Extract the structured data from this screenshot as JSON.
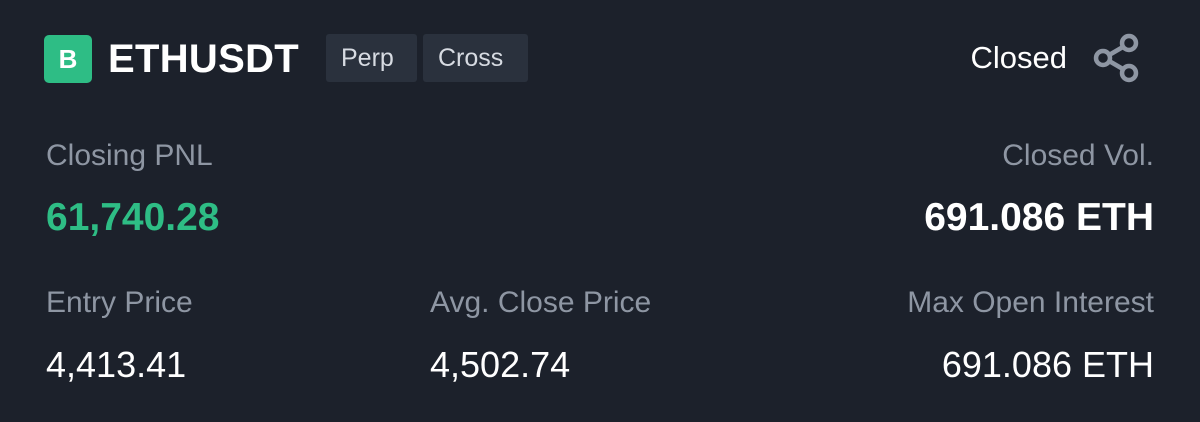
{
  "header": {
    "side_badge": "B",
    "symbol": "ETHUSDT",
    "tags": [
      "Perp",
      "Cross"
    ],
    "status": "Closed",
    "share_icon": "share-icon"
  },
  "stats": {
    "closing_pnl": {
      "label": "Closing PNL",
      "value": "61,740.28"
    },
    "closed_vol": {
      "label": "Closed Vol.",
      "value": "691.086 ETH"
    },
    "entry_price": {
      "label": "Entry Price",
      "value": "4,413.41"
    },
    "avg_close_price": {
      "label": "Avg. Close Price",
      "value": "4,502.74"
    },
    "max_open_interest": {
      "label": "Max Open Interest",
      "value": "691.086 ETH"
    }
  },
  "colors": {
    "background": "#1c212b",
    "positive": "#2ebd85",
    "tag_background": "#2a313d",
    "label_text": "#8e96a3",
    "value_text": "#ffffff"
  }
}
